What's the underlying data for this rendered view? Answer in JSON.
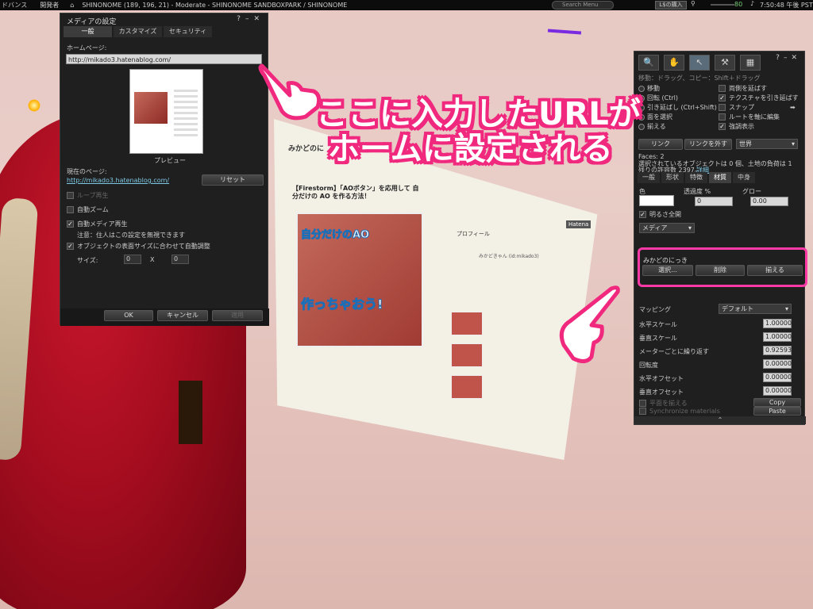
{
  "topbar": {
    "menu_balance": "ドバンス",
    "menu_dev": "開発者",
    "location": "SHINONOME (189, 196, 21) - Moderate - SHINONOME SANDBOXPARK / SHINONOME",
    "search_placeholder": "Search Menu",
    "buy_label": "L$の購入",
    "fps": "80",
    "time": "7:50:48 午後 PST"
  },
  "media_floater": {
    "title": "メディアの設定",
    "tabs": [
      "一般",
      "カスタマイズ",
      "セキュリティ"
    ],
    "homepage_label": "ホームページ:",
    "homepage_value": "http://mikado3.hatenablog.com/",
    "preview_caption": "プレビュー",
    "current_label": "現在のページ:",
    "current_url": "http://mikado3.hatenablog.com/",
    "reset_label": "リセット",
    "loop_label": "ループ再生",
    "auto_zoom_label": "自動ズーム",
    "auto_play_label": "自動メディア再生",
    "auto_play_note": "注意：住人はこの設定を無視できます",
    "auto_scale_label": "オブジェクトの表面サイズに合わせて自動調整",
    "size_label": "サイズ:",
    "size_w": "0",
    "size_x": "X",
    "size_h": "0",
    "ok_label": "OK",
    "cancel_label": "キャンセル",
    "apply_label": "適用"
  },
  "screen3d": {
    "blog_title": "みかどのに",
    "article_head": "【Firestorm】「AOボタン」を応用して 自分だけの AO を作る方法！",
    "image_text_1": "自分だけのAO",
    "image_text_2": "作っちゃおう!",
    "profile_label": "プロフィール",
    "profile_name": "みかどきゃん (id:mikado3)",
    "hatena": "Hatena"
  },
  "build_floater": {
    "hint": "移動：ドラッグ、コピー：Shift＋ドラッグ",
    "radio_move": "移動",
    "radio_rotate": "回転 (Ctrl)",
    "radio_stretch": "引き延ばし (Ctrl+Shift)",
    "radio_face": "面を選択",
    "radio_align": "揃える",
    "cb_both_sides": "両側を延ばす",
    "cb_stretch_tex": "テクスチャを引き延ばす",
    "cb_snap": "スナップ",
    "cb_edit_linked": "ルートを軸に編集",
    "cb_highlight": "強調表示",
    "link_btn": "リンク",
    "unlink_btn": "リンクを外す",
    "world_dd": "世界",
    "faces": "Faces: 2",
    "selection_info": "選択されているオブジェクトは 0 個、土地の負荷は 1",
    "remaining": "残りの許容数 2397。",
    "more_link": "詳細",
    "tabs": [
      "一般",
      "形状",
      "特徴",
      "材質",
      "中身"
    ],
    "color_label": "色",
    "transparency_label": "透過度 %",
    "transparency_value": "0",
    "glow_label": "グロー",
    "glow_value": "0.00",
    "full_bright": "明るさ全開",
    "media_dd": "メディア",
    "media_name": "みかどのにっき",
    "choose_btn": "選択...",
    "delete_btn": "削除",
    "align_btn": "揃える",
    "mapping_label": "マッピング",
    "mapping_value": "デフォルト",
    "h_scale_label": "水平スケール",
    "h_scale": "1.00000",
    "v_scale_label": "垂直スケール",
    "v_scale": "1.00000",
    "repeat_label": "メーターごとに繰り返す",
    "repeat": "0.92593",
    "rotation_label": "回転度",
    "rotation": "0.00000",
    "h_offset_label": "水平オフセット",
    "h_offset": "0.00000",
    "v_offset_label": "垂直オフセット",
    "v_offset": "0.00000",
    "align_planar": "平面を揃える",
    "sync_materials": "Synchronize materials",
    "copy_btn": "Copy",
    "paste_btn": "Paste"
  },
  "annotation": {
    "line1": "ここに入力したURLが",
    "line2": "ホームに設定される"
  },
  "colors": {
    "accent": "#f0287e",
    "frame": "#1f1f1f",
    "box_border": "#ff3aa6"
  }
}
